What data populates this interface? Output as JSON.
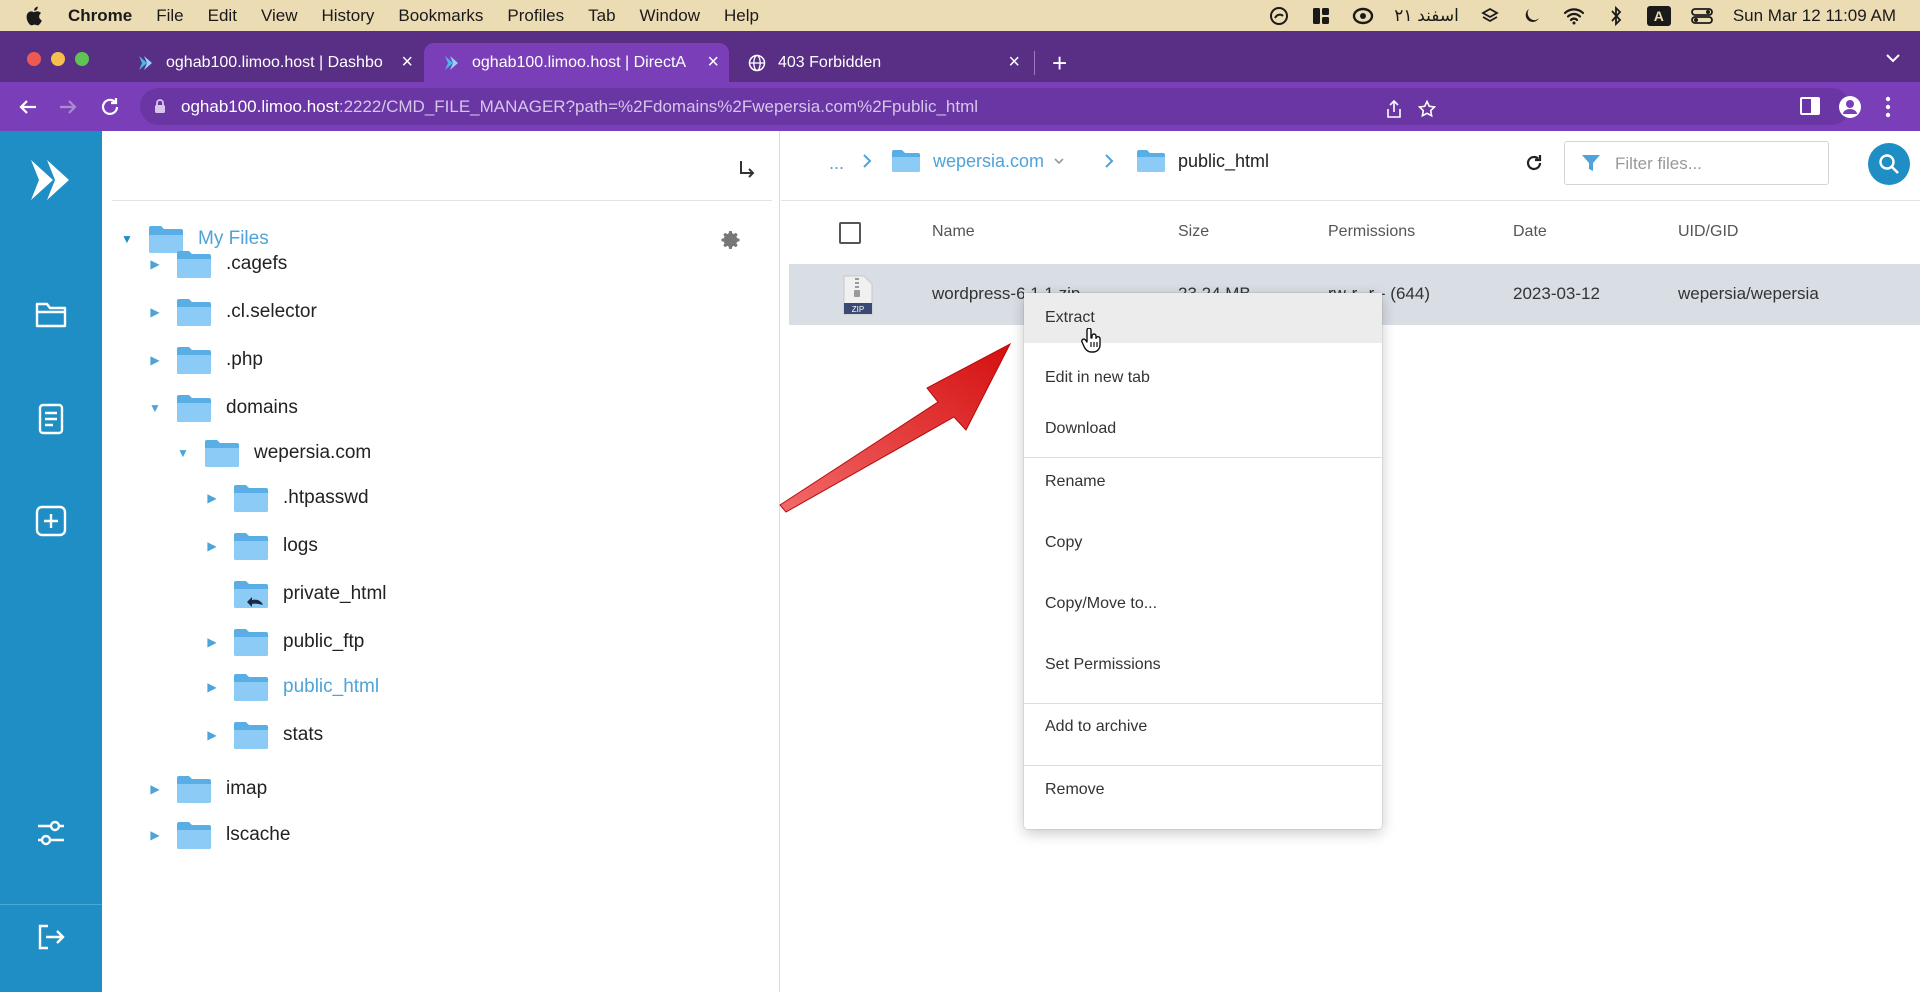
{
  "menubar": {
    "app": "Chrome",
    "items": [
      "File",
      "Edit",
      "View",
      "History",
      "Bookmarks",
      "Profiles",
      "Tab",
      "Window",
      "Help"
    ],
    "persian_date": "۲۱ اسفند",
    "keyboard_indicator": "A",
    "datetime": "Sun Mar 12  11:09 AM"
  },
  "tabs": [
    {
      "title": "oghab100.limoo.host | Dashbo",
      "icon": "directadmin-icon",
      "active": false
    },
    {
      "title": "oghab100.limoo.host | DirectA",
      "icon": "directadmin-icon",
      "active": true
    },
    {
      "title": "403 Forbidden",
      "icon": "globe-icon",
      "active": false
    }
  ],
  "toolbar": {
    "url_host": "oghab100.limoo.host",
    "url_rest": ":2222/CMD_FILE_MANAGER?path=%2Fdomains%2Fwepersia.com%2Fpublic_html"
  },
  "tree": {
    "root": "My Files",
    "items": [
      {
        "label": ".cagefs",
        "level": 1,
        "caret": "right"
      },
      {
        "label": ".cl.selector",
        "level": 1,
        "caret": "right"
      },
      {
        "label": ".php",
        "level": 1,
        "caret": "right"
      },
      {
        "label": "domains",
        "level": 1,
        "caret": "down"
      },
      {
        "label": "wepersia.com",
        "level": 2,
        "caret": "down"
      },
      {
        "label": ".htpasswd",
        "level": 3,
        "caret": "right"
      },
      {
        "label": "logs",
        "level": 3,
        "caret": "right"
      },
      {
        "label": "private_html",
        "level": 3,
        "caret": "none",
        "symlink": true
      },
      {
        "label": "public_ftp",
        "level": 3,
        "caret": "right"
      },
      {
        "label": "public_html",
        "level": 3,
        "caret": "right",
        "active": true
      },
      {
        "label": "stats",
        "level": 3,
        "caret": "right"
      },
      {
        "label": "imap",
        "level": 1,
        "caret": "right"
      },
      {
        "label": "lscache",
        "level": 1,
        "caret": "right"
      }
    ]
  },
  "breadcrumb": {
    "ellipsis": "...",
    "domain": "wepersia.com",
    "current": "public_html"
  },
  "filter": {
    "placeholder": "Filter files..."
  },
  "columns": [
    "Name",
    "Size",
    "Permissions",
    "Date",
    "UID/GID"
  ],
  "file": {
    "name": "wordpress-6.1.1.zip",
    "size": "23.24 MB",
    "permissions": "rw-r--r-- (644)",
    "date": "2023-03-12",
    "owner": "wepersia/wepersia",
    "icon_label": "ZIP"
  },
  "context_menu": [
    "Extract",
    "Edit in new tab",
    "Download",
    "Rename",
    "Copy",
    "Copy/Move to...",
    "Set Permissions",
    "Add to archive",
    "Remove"
  ],
  "colors": {
    "tabstrip": "#592f86",
    "toolbar": "#7a3fb8",
    "sidebar": "#1f8ec4",
    "accent_link": "#4ea3d8",
    "arrow": "#e01b1b"
  }
}
